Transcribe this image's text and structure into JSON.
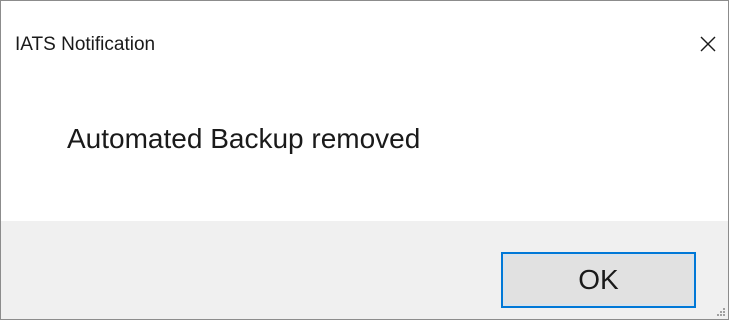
{
  "window": {
    "title": "IATS Notification",
    "close_icon": "close-icon"
  },
  "content": {
    "message": "Automated Backup removed"
  },
  "footer": {
    "ok_label": "OK"
  },
  "colors": {
    "accent": "#0078d7",
    "footer_bg": "#f0f0f0",
    "button_bg": "#e1e1e1",
    "text": "#1a1a1a"
  }
}
